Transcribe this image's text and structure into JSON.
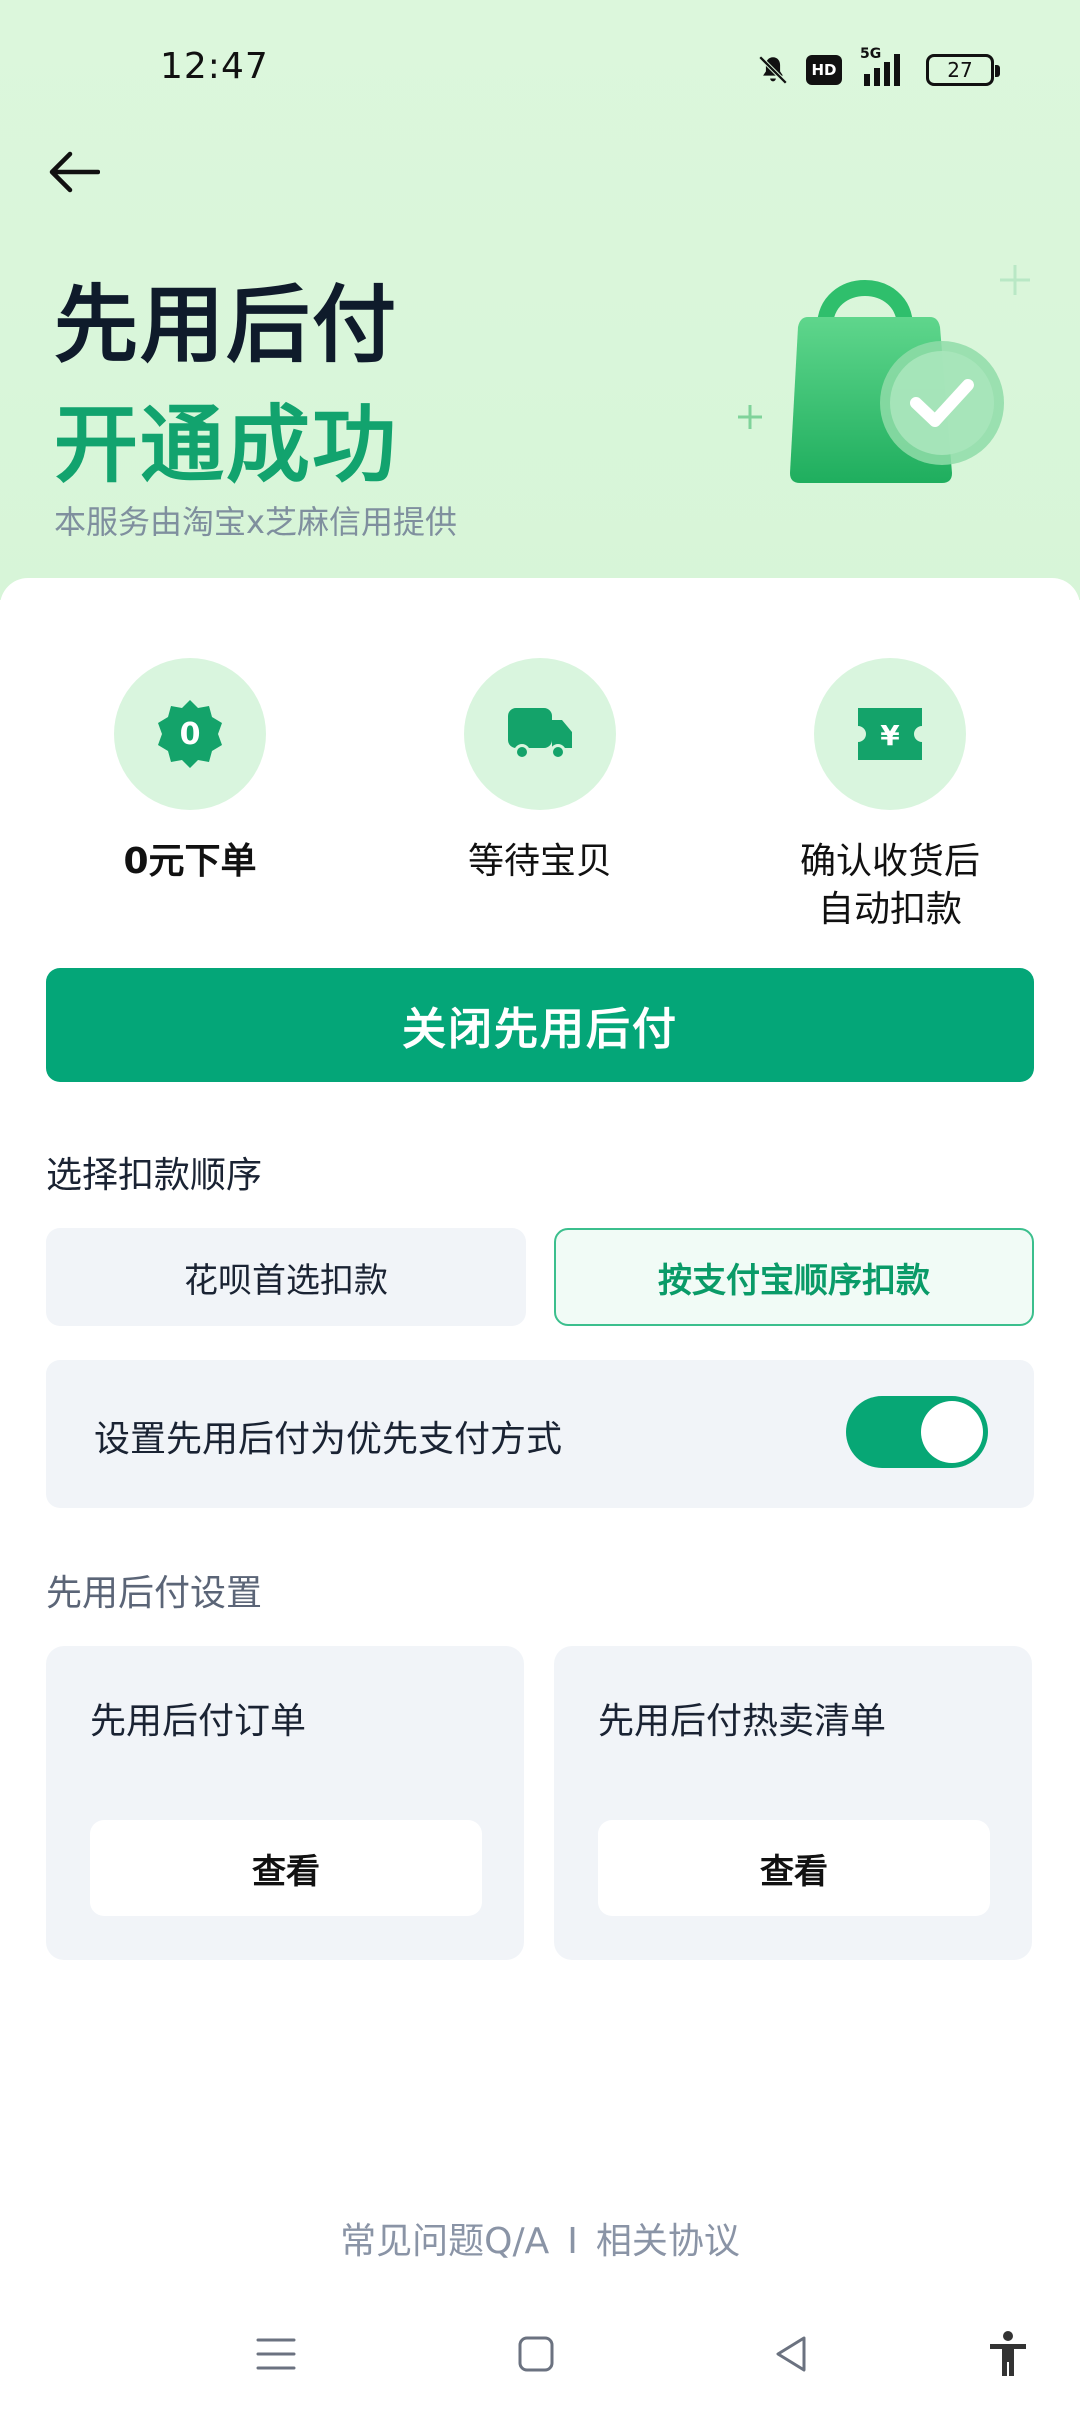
{
  "status_bar": {
    "time": "12:47",
    "battery": "27",
    "hd_label": "HD",
    "network": "5G",
    "icons": [
      "bell-off-icon",
      "hd-icon",
      "signal-5g-icon",
      "battery-icon"
    ]
  },
  "header": {
    "back_icon": "arrow-left-icon",
    "title": "先用后付",
    "subtitle": "开通成功",
    "note": "本服务由淘宝x芝麻信用提供",
    "illustration": "shopping-bag-check-icon"
  },
  "steps": [
    {
      "icon": "zero-badge-icon",
      "icon_text": "0",
      "label": "0元下单"
    },
    {
      "icon": "truck-icon",
      "label": "等待宝贝"
    },
    {
      "icon": "yen-ticket-icon",
      "icon_text": "¥",
      "label_line1": "确认收货后",
      "label_line2": "自动扣款"
    }
  ],
  "primary_action": {
    "label": "关闭先用后付"
  },
  "deduction_order": {
    "label": "选择扣款顺序",
    "options": [
      {
        "label": "花呗首选扣款",
        "selected": false
      },
      {
        "label": "按支付宝顺序扣款",
        "selected": true
      }
    ]
  },
  "preference": {
    "label": "设置先用后付为优先支付方式",
    "enabled": true
  },
  "settings": {
    "label": "先用后付设置",
    "tiles": [
      {
        "title": "先用后付订单",
        "button": "查看"
      },
      {
        "title": "先用后付热卖清单",
        "button": "查看"
      }
    ]
  },
  "footer": {
    "faq": "常见问题Q/A",
    "separator": "I",
    "agreement": "相关协议"
  },
  "nav_bar": {
    "icons": [
      "menu-icon",
      "home-square-icon",
      "back-triangle-icon",
      "accessibility-icon"
    ]
  },
  "colors": {
    "accent": "#04a678",
    "hero_bg": "#d7f5d8",
    "step_bg": "#d9f5de"
  }
}
